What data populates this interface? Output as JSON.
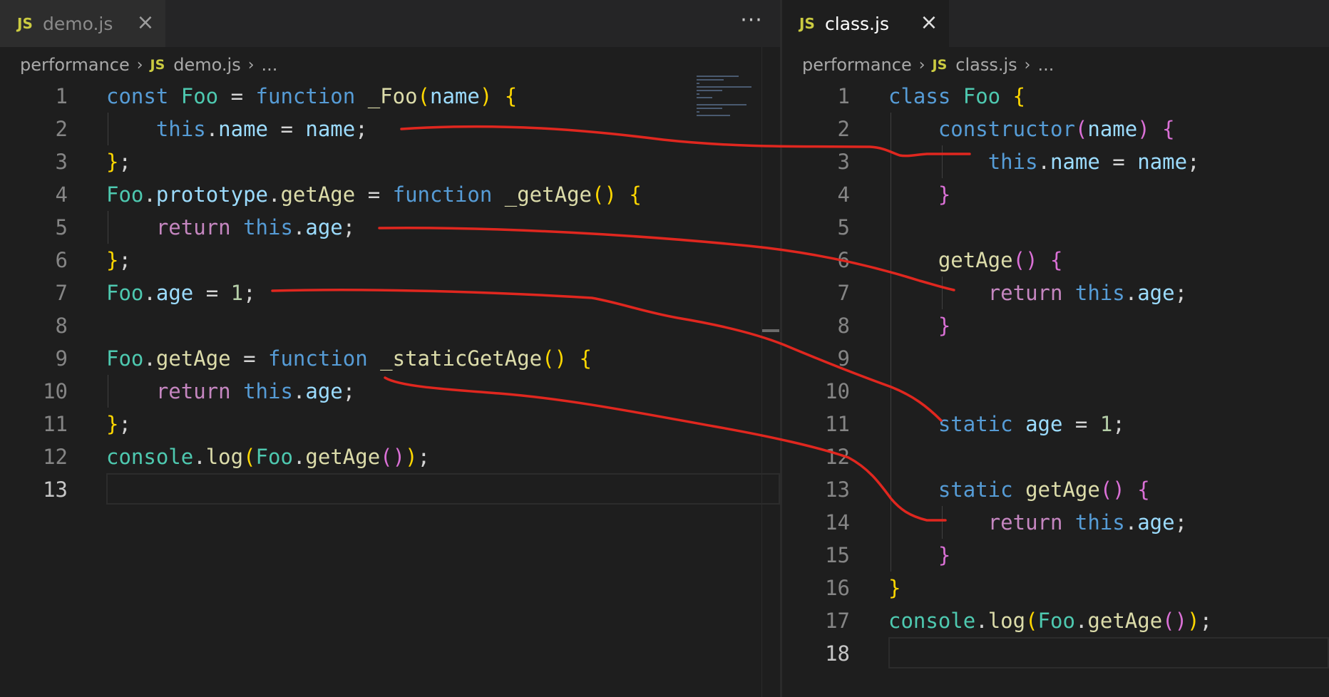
{
  "left_editor": {
    "tab": {
      "icon": "JS",
      "label": "demo.js",
      "close": "×"
    },
    "more_actions": "···",
    "breadcrumb": {
      "folder": "performance",
      "icon": "JS",
      "file": "demo.js",
      "ellipsis": "..."
    },
    "line_numbers": [
      "1",
      "2",
      "3",
      "4",
      "5",
      "6",
      "7",
      "8",
      "9",
      "10",
      "11",
      "12",
      "13"
    ],
    "lines": [
      [
        [
          "kw",
          "const "
        ],
        [
          "cls",
          "Foo"
        ],
        [
          "p",
          " = "
        ],
        [
          "kw",
          "function "
        ],
        [
          "fn",
          "_Foo"
        ],
        [
          "b1",
          "("
        ],
        [
          "var",
          "name"
        ],
        [
          "b1",
          ")"
        ],
        [
          "p",
          " "
        ],
        [
          "b1",
          "{"
        ]
      ],
      [
        [
          "p",
          "    "
        ],
        [
          "kw",
          "this"
        ],
        [
          "p",
          "."
        ],
        [
          "var",
          "name"
        ],
        [
          "p",
          " = "
        ],
        [
          "var",
          "name"
        ],
        [
          "p",
          ";"
        ]
      ],
      [
        [
          "b1",
          "}"
        ],
        [
          "p",
          ";"
        ]
      ],
      [
        [
          "cls",
          "Foo"
        ],
        [
          "p",
          "."
        ],
        [
          "var",
          "prototype"
        ],
        [
          "p",
          "."
        ],
        [
          "fn",
          "getAge"
        ],
        [
          "p",
          " = "
        ],
        [
          "kw",
          "function "
        ],
        [
          "fn",
          "_getAge"
        ],
        [
          "b1",
          "()"
        ],
        [
          "p",
          " "
        ],
        [
          "b1",
          "{"
        ]
      ],
      [
        [
          "p",
          "    "
        ],
        [
          "ctl",
          "return "
        ],
        [
          "kw",
          "this"
        ],
        [
          "p",
          "."
        ],
        [
          "var",
          "age"
        ],
        [
          "p",
          ";"
        ]
      ],
      [
        [
          "b1",
          "}"
        ],
        [
          "p",
          ";"
        ]
      ],
      [
        [
          "cls",
          "Foo"
        ],
        [
          "p",
          "."
        ],
        [
          "var",
          "age"
        ],
        [
          "p",
          " = "
        ],
        [
          "num",
          "1"
        ],
        [
          "p",
          ";"
        ]
      ],
      [],
      [
        [
          "cls",
          "Foo"
        ],
        [
          "p",
          "."
        ],
        [
          "fn",
          "getAge"
        ],
        [
          "p",
          " = "
        ],
        [
          "kw",
          "function "
        ],
        [
          "fn",
          "_staticGetAge"
        ],
        [
          "b1",
          "()"
        ],
        [
          "p",
          " "
        ],
        [
          "b1",
          "{"
        ]
      ],
      [
        [
          "p",
          "    "
        ],
        [
          "ctl",
          "return "
        ],
        [
          "kw",
          "this"
        ],
        [
          "p",
          "."
        ],
        [
          "var",
          "age"
        ],
        [
          "p",
          ";"
        ]
      ],
      [
        [
          "b1",
          "}"
        ],
        [
          "p",
          ";"
        ]
      ],
      [
        [
          "cls",
          "console"
        ],
        [
          "p",
          "."
        ],
        [
          "fn",
          "log"
        ],
        [
          "b1",
          "("
        ],
        [
          "cls",
          "Foo"
        ],
        [
          "p",
          "."
        ],
        [
          "fn",
          "getAge"
        ],
        [
          "b2",
          "()"
        ],
        [
          "b1",
          ")"
        ],
        [
          "p",
          ";"
        ]
      ],
      []
    ]
  },
  "right_editor": {
    "tab": {
      "icon": "JS",
      "label": "class.js",
      "close": "×"
    },
    "breadcrumb": {
      "folder": "performance",
      "icon": "JS",
      "file": "class.js",
      "ellipsis": "..."
    },
    "line_numbers": [
      "1",
      "2",
      "3",
      "4",
      "5",
      "6",
      "7",
      "8",
      "9",
      "10",
      "11",
      "12",
      "13",
      "14",
      "15",
      "16",
      "17",
      "18"
    ],
    "lines": [
      [
        [
          "kw",
          "class "
        ],
        [
          "cls",
          "Foo"
        ],
        [
          "p",
          " "
        ],
        [
          "b1",
          "{"
        ]
      ],
      [
        [
          "p",
          "    "
        ],
        [
          "kw",
          "constructor"
        ],
        [
          "b2",
          "("
        ],
        [
          "var",
          "name"
        ],
        [
          "b2",
          ")"
        ],
        [
          "p",
          " "
        ],
        [
          "b2",
          "{"
        ]
      ],
      [
        [
          "p",
          "        "
        ],
        [
          "kw",
          "this"
        ],
        [
          "p",
          "."
        ],
        [
          "var",
          "name"
        ],
        [
          "p",
          " = "
        ],
        [
          "var",
          "name"
        ],
        [
          "p",
          ";"
        ]
      ],
      [
        [
          "p",
          "    "
        ],
        [
          "b2",
          "}"
        ]
      ],
      [],
      [
        [
          "p",
          "    "
        ],
        [
          "fn",
          "getAge"
        ],
        [
          "b2",
          "()"
        ],
        [
          "p",
          " "
        ],
        [
          "b2",
          "{"
        ]
      ],
      [
        [
          "p",
          "        "
        ],
        [
          "ctl",
          "return "
        ],
        [
          "kw",
          "this"
        ],
        [
          "p",
          "."
        ],
        [
          "var",
          "age"
        ],
        [
          "p",
          ";"
        ]
      ],
      [
        [
          "p",
          "    "
        ],
        [
          "b2",
          "}"
        ]
      ],
      [],
      [],
      [
        [
          "p",
          "    "
        ],
        [
          "kw",
          "static "
        ],
        [
          "var",
          "age"
        ],
        [
          "p",
          " = "
        ],
        [
          "num",
          "1"
        ],
        [
          "p",
          ";"
        ]
      ],
      [],
      [
        [
          "p",
          "    "
        ],
        [
          "kw",
          "static "
        ],
        [
          "fn",
          "getAge"
        ],
        [
          "b2",
          "()"
        ],
        [
          "p",
          " "
        ],
        [
          "b2",
          "{"
        ]
      ],
      [
        [
          "p",
          "        "
        ],
        [
          "ctl",
          "return "
        ],
        [
          "kw",
          "this"
        ],
        [
          "p",
          "."
        ],
        [
          "var",
          "age"
        ],
        [
          "p",
          ";"
        ]
      ],
      [
        [
          "p",
          "    "
        ],
        [
          "b2",
          "}"
        ]
      ],
      [
        [
          "b1",
          "}"
        ]
      ],
      [
        [
          "cls",
          "console"
        ],
        [
          "p",
          "."
        ],
        [
          "fn",
          "log"
        ],
        [
          "b1",
          "("
        ],
        [
          "cls",
          "Foo"
        ],
        [
          "p",
          "."
        ],
        [
          "fn",
          "getAge"
        ],
        [
          "b2",
          "()"
        ],
        [
          "b1",
          ")"
        ],
        [
          "p",
          ";"
        ]
      ],
      []
    ]
  },
  "colors": {
    "editor_background": "#1e1e1e",
    "annotation_stroke": "#e0271f",
    "keyword": "#569cd6",
    "control": "#c586c0",
    "function": "#dcdcaa",
    "variable": "#9cdcfe",
    "class": "#4ec9b0",
    "number": "#b5cea8"
  }
}
